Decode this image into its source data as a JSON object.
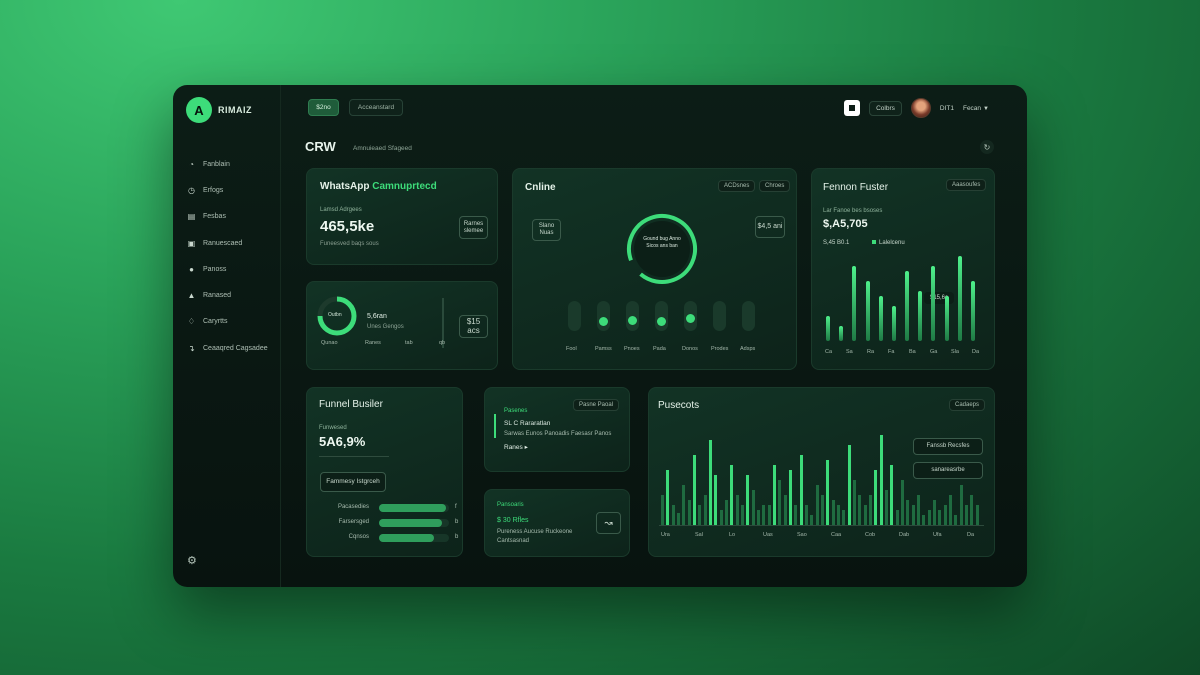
{
  "brand": {
    "logo": "A",
    "name": "RIMAIZ"
  },
  "topbar": {
    "chip1": "$2no",
    "chip2": "Acceanstard",
    "icon_chip": "Colbrs",
    "user_label": "DIT1",
    "user_menu": "Fecan"
  },
  "sidebar": {
    "items": [
      {
        "icon": "gauge-icon",
        "label": "Fanblain"
      },
      {
        "icon": "clock-icon",
        "label": "Erfogs"
      },
      {
        "icon": "document-icon",
        "label": "Fesbas"
      },
      {
        "icon": "chat-icon",
        "label": "Ranuescaed"
      },
      {
        "icon": "circle-icon",
        "label": "Panoss"
      },
      {
        "icon": "trend-icon",
        "label": "Ranased"
      },
      {
        "icon": "shield-icon",
        "label": "Caryrtts"
      },
      {
        "icon": "export-icon",
        "label": "Ceaaqred Cagsadee"
      }
    ],
    "bottom_icon": "settings-icon"
  },
  "page": {
    "title": "CRW",
    "subtitle": "Amnuieaed Sfageed"
  },
  "whatsapp": {
    "title_a": "WhatsApp",
    "title_b": "Camnuprtecd",
    "sublabel": "Lamsd Adrgees",
    "value": "465,5ke",
    "caption": "Funeesved baqs sous",
    "button": "Rarnes slemee"
  },
  "ring_card": {
    "ring_text": "Outbn",
    "value": "5,6ran",
    "caption": "Unes Gengos",
    "button": "$15 acs",
    "labels": [
      "Qunao",
      "Ranes",
      "tab",
      "qb"
    ]
  },
  "online": {
    "title": "Cnline",
    "pill1": "ACDsnes",
    "pill2": "Chroes",
    "left_box": "Slano Nuas",
    "right_box": "$4,5 ani",
    "ring_text": "Gound bug Anno Sicos ans ban",
    "axis": [
      "Fool",
      "Pamss",
      "Pnoes",
      "Pada",
      "Donos",
      "Prodes",
      "Adsps"
    ],
    "slider_levels": [
      0,
      0.3,
      0.4,
      0.3,
      0.6,
      0,
      0
    ]
  },
  "fennon": {
    "title": "Fennon Fuster",
    "pill": "Aaasoufes",
    "sublabel": "Lar Fanoe bes bsoses",
    "value": "$,A5,705",
    "legend1": "S,45 B0.1",
    "legend2": "Lalelcenu",
    "tooltip": "$15,6c",
    "axis": [
      "Ca",
      "Sa",
      "Ra",
      "Fa",
      "Ba",
      "Ga",
      "Sla",
      "Da"
    ],
    "bars": [
      0.25,
      0.15,
      0.75,
      0.6,
      0.45,
      0.35,
      0.7,
      0.5,
      0.75,
      0.45,
      0.85,
      0.6
    ]
  },
  "funnel": {
    "title": "Funnel Busiler",
    "sublabel": "Funwesed",
    "value": "5A6,9%",
    "button": "Fammesy Istgrceh",
    "rows": [
      {
        "label": "Pacasedies",
        "fill": 0.95,
        "end": "f"
      },
      {
        "label": "Farsersged",
        "fill": 0.9,
        "end": "b"
      },
      {
        "label": "Cqnsos",
        "fill": 0.78,
        "end": "b"
      }
    ]
  },
  "mini_top": {
    "title": "Pasenes",
    "pill": "Pasne Paoal",
    "line1": "SL C Rararatlan",
    "line2": "Sarwas Eunos Panoadis Faesasr Panos",
    "link": "Ranes"
  },
  "mini_bottom": {
    "title": "Pansoaris",
    "value": "$ 30 Rfles",
    "line1": "Pureness Aucuse Ruckeone",
    "line2": "Cantsasnad"
  },
  "pusecots": {
    "title": "Pusecots",
    "pill": "Cadaeps",
    "btn1": "Fanssb Recsfes",
    "btn2": "sanareasrbe",
    "axis": [
      "Ura",
      "Sal",
      "Lo",
      "Uas",
      "Sao",
      "Caa",
      "Cob",
      "Dab",
      "Ufa",
      "Da"
    ],
    "bars": [
      0.3,
      0.55,
      0.2,
      0.12,
      0.4,
      0.25,
      0.7,
      0.2,
      0.3,
      0.85,
      0.5,
      0.15,
      0.25,
      0.6,
      0.3,
      0.2,
      0.5,
      0.35,
      0.15,
      0.2,
      0.2,
      0.6,
      0.45,
      0.3,
      0.55,
      0.2,
      0.7,
      0.2,
      0.1,
      0.4,
      0.3,
      0.65,
      0.25,
      0.2,
      0.15,
      0.8,
      0.45,
      0.3,
      0.2,
      0.3,
      0.55,
      0.9,
      0.35,
      0.6,
      0.15,
      0.45,
      0.25,
      0.2,
      0.3,
      0.1,
      0.15,
      0.25,
      0.15,
      0.2,
      0.3,
      0.1,
      0.4,
      0.2,
      0.3,
      0.2
    ]
  },
  "colors": {
    "accent": "#3ddc7a",
    "panel": "#0c1d16",
    "card": "#123325"
  }
}
